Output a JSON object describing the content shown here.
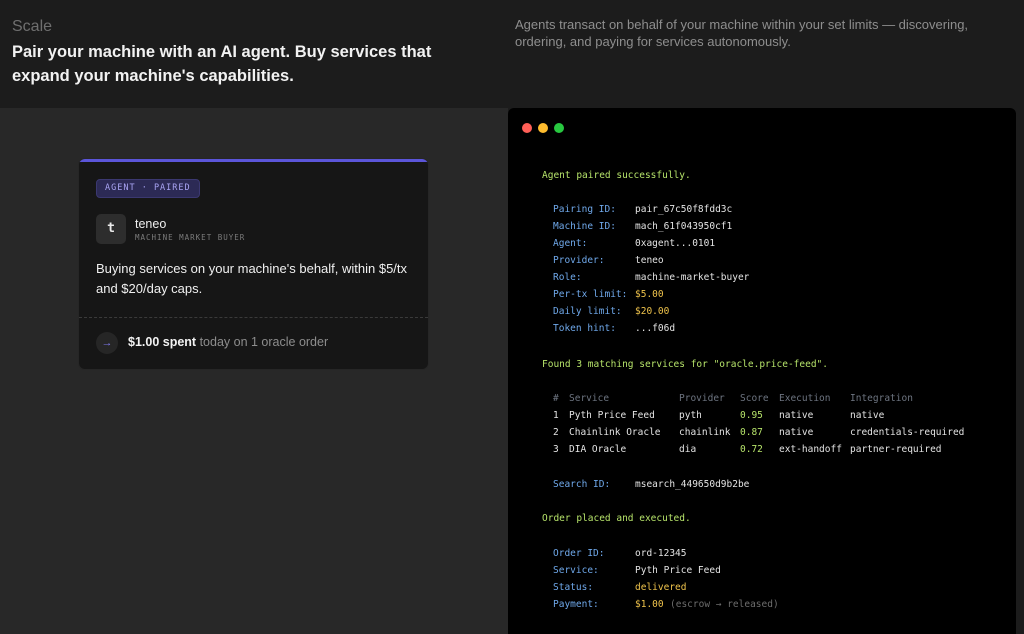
{
  "header": {
    "eyebrow": "Scale",
    "headline": "Pair your machine with an AI agent. Buy services that expand your machine's capabilities.",
    "subcopy": "Agents transact on behalf of your machine within your set limits — discovering, ordering, and paying for services autonomously."
  },
  "card": {
    "badge": "AGENT · PAIRED",
    "avatar_letter": "t",
    "provider": "teneo",
    "role": "MACHINE MARKET BUYER",
    "description": "Buying services on your machine's behalf, within $5/tx and $20/day caps.",
    "footer_icon": "→",
    "footer_amount": "$1.00 spent",
    "footer_rest": " today on 1 oracle order"
  },
  "terminal": {
    "window_dots": [
      "#ff5f57",
      "#febc2e",
      "#28c840"
    ],
    "pair_success": "Agent paired successfully.",
    "pairing": [
      {
        "key": "Pairing ID:",
        "value": "pair_67c50f8fdd3c"
      },
      {
        "key": "Machine ID:",
        "value": "mach_61f043950cf1"
      },
      {
        "key": "Agent:",
        "value": "0xagent...0101"
      },
      {
        "key": "Provider:",
        "value": "teneo"
      },
      {
        "key": "Role:",
        "value": "machine-market-buyer"
      },
      {
        "key": "Per-tx limit:",
        "value": "$5.00",
        "highlight": true
      },
      {
        "key": "Daily limit:",
        "value": "$20.00",
        "highlight": true
      },
      {
        "key": "Token hint:",
        "value": "...f06d"
      }
    ],
    "found": "Found 3 matching services for \"oracle.price-feed\".",
    "table_headers": [
      "#",
      "Service",
      "Provider",
      "Score",
      "Execution",
      "Integration"
    ],
    "table_rows": [
      [
        "1",
        "Pyth Price Feed",
        "pyth",
        "0.95",
        "native",
        "native"
      ],
      [
        "2",
        "Chainlink Oracle",
        "chainlink",
        "0.87",
        "native",
        "credentials-required"
      ],
      [
        "3",
        "DIA Oracle",
        "dia",
        "0.72",
        "ext-handoff",
        "partner-required"
      ]
    ],
    "search": {
      "key": "Search ID:",
      "value": "msearch_449650d9b2be"
    },
    "order_success": "Order placed and executed.",
    "order": [
      {
        "key": "Order ID:",
        "value": "ord-12345"
      },
      {
        "key": "Service:",
        "value": "Pyth Price Feed"
      },
      {
        "key": "Status:",
        "value": "delivered",
        "highlight": true
      },
      {
        "key": "Payment:",
        "value": "$1.00",
        "highlight": true,
        "note": "(escrow → released)"
      }
    ]
  },
  "colors": {
    "accent": "#5b55d9",
    "terminal_key": "#6fa8ea",
    "terminal_success": "#b6e36a",
    "terminal_highlight": "#f0c44c"
  }
}
